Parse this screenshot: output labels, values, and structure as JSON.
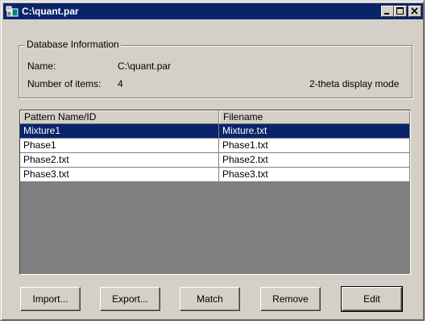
{
  "window": {
    "title": "C:\\quant.par"
  },
  "database_info": {
    "group_title": "Database Information",
    "name_label": "Name:",
    "name_value": "C:\\quant.par",
    "items_label": "Number of items:",
    "items_value": "4",
    "display_mode": "2-theta display mode"
  },
  "list": {
    "columns": [
      "Pattern Name/ID",
      "Filename"
    ],
    "rows": [
      {
        "name": "Mixture1",
        "file": "Mixture.txt",
        "selected": true
      },
      {
        "name": "Phase1",
        "file": "Phase1.txt",
        "selected": false
      },
      {
        "name": "Phase2.txt",
        "file": "Phase2.txt",
        "selected": false
      },
      {
        "name": "Phase3.txt",
        "file": "Phase3.txt",
        "selected": false
      }
    ]
  },
  "buttons": {
    "import": "Import...",
    "export": "Export...",
    "match": "Match",
    "remove": "Remove",
    "edit": "Edit"
  },
  "colors": {
    "titlebar": "#0a246a",
    "face": "#d4d0c8",
    "selection": "#0a246a"
  }
}
